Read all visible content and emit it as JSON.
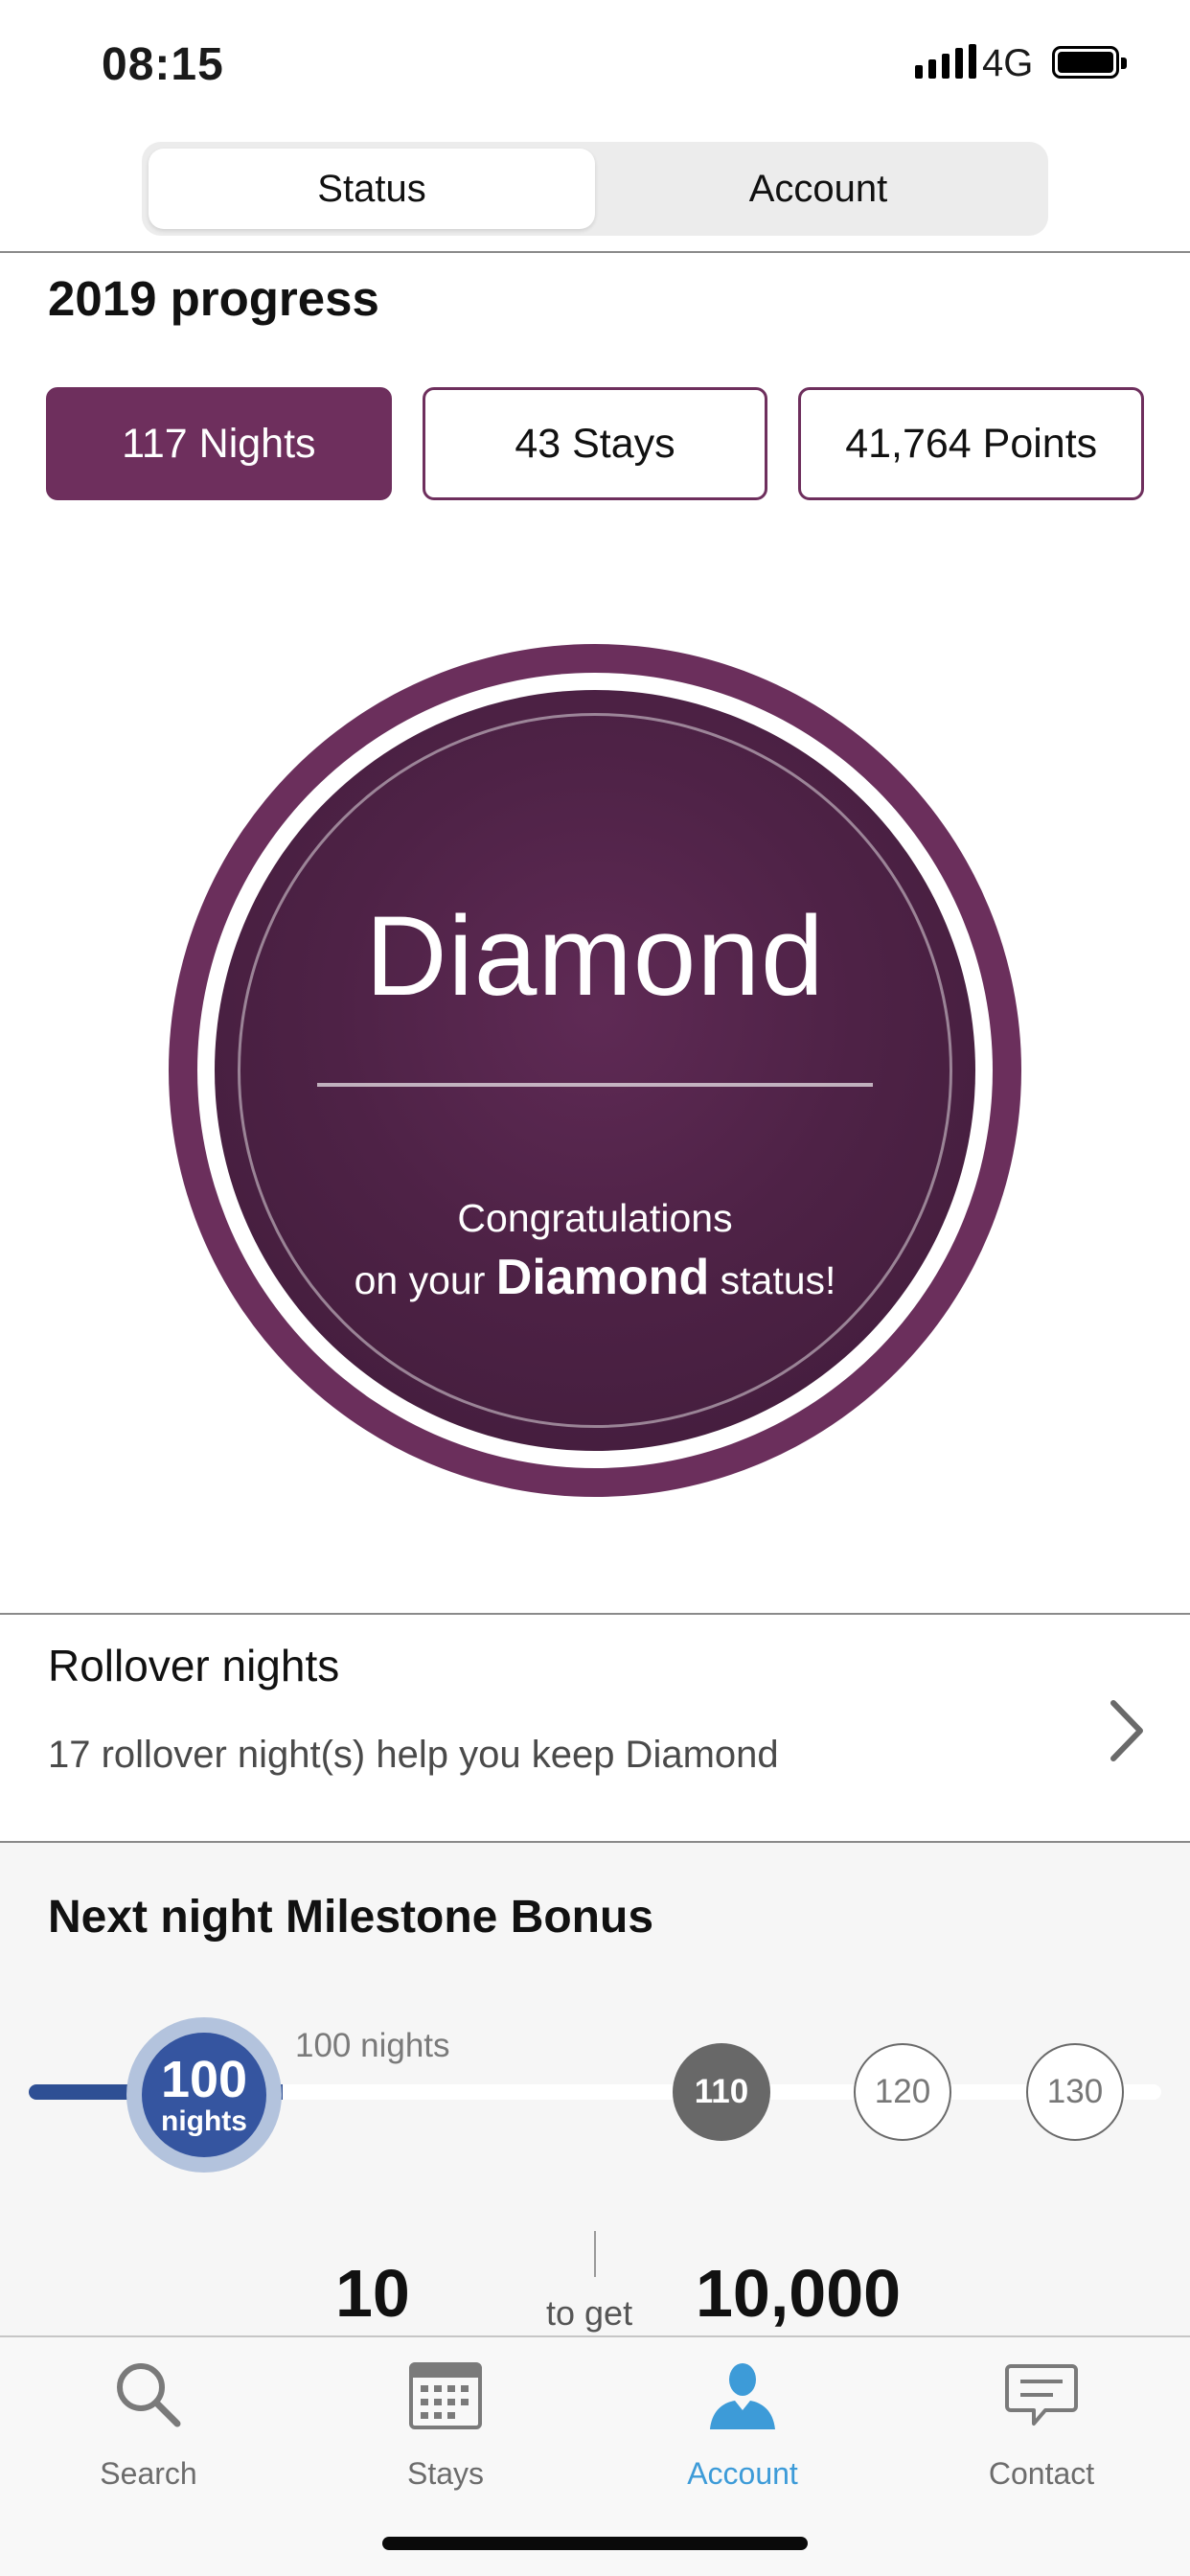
{
  "status_bar": {
    "time": "08:15",
    "network": "4G"
  },
  "segmented": {
    "status_label": "Status",
    "account_label": "Account",
    "selected": "Status"
  },
  "progress": {
    "title": "2019 progress",
    "tabs": [
      {
        "label": "117 Nights",
        "active": true
      },
      {
        "label": "43 Stays",
        "active": false
      },
      {
        "label": "41,764 Points",
        "active": false
      }
    ]
  },
  "badge": {
    "tier": "Diamond",
    "line1": "Congratulations",
    "line2_pre": "on your",
    "line2_bold": "Diamond",
    "line2_post": "status!",
    "colors": {
      "outer": "#6b2f5c",
      "core": "#4e2246"
    }
  },
  "rollover": {
    "title": "Rollover nights",
    "subtitle": "17 rollover night(s) help you keep Diamond"
  },
  "milestone": {
    "title": "Next night Milestone Bonus",
    "current": {
      "number": "100",
      "unit": "nights",
      "label": "100 nights"
    },
    "nodes": [
      "110",
      "120",
      "130"
    ],
    "nights_to_go": "10",
    "connector": "to get",
    "bonus_points": "10,000"
  },
  "tabbar": {
    "items": [
      {
        "label": "Search",
        "icon": "search-icon"
      },
      {
        "label": "Stays",
        "icon": "calendar-icon"
      },
      {
        "label": "Account",
        "icon": "person-icon",
        "active": true
      },
      {
        "label": "Contact",
        "icon": "chat-bubble-icon"
      }
    ],
    "active_color": "#3d9bd8"
  }
}
